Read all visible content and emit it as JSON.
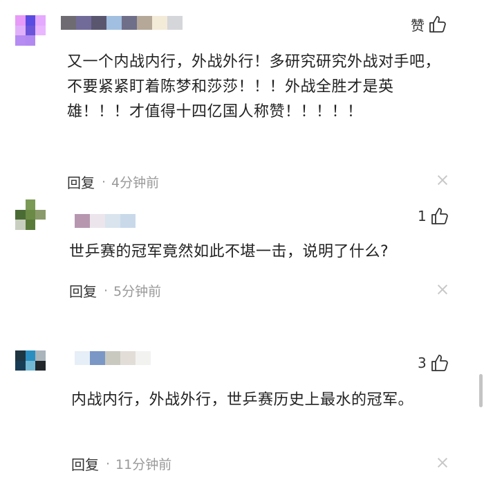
{
  "comments": [
    {
      "like_label": "赞",
      "content": "又一个内战内行，外战外行！多研究研究外战对手吧，不要紧紧盯着陈梦和莎莎！！！外战全胜才是英雄！！！才值得十四亿国人称赞！！！！！",
      "reply_label": "回复",
      "dot": "·",
      "time": "4分钟前",
      "avatar_colors": [
        "#e79af7",
        "#5a4be2",
        "#e5a9ff",
        "#e1b0fb",
        "#6b54d9",
        "#e9b6ff",
        "#b68bf2",
        "#b289f0",
        "#ffffff"
      ],
      "name_colors": [
        "#6e6c72",
        "#716b99",
        "#5b5670",
        "#a1bfe0",
        "#6f6f8a",
        "#b5a898",
        "#f3ead8",
        "#d4d6da"
      ]
    },
    {
      "like_count": "1",
      "content": "世乒赛的冠军竟然如此不堪一击，说明了什么?",
      "reply_label": "回复",
      "dot": "·",
      "time": "5分钟前",
      "avatar_colors": [
        "#ffffff",
        "#7a9a55",
        "#ffffff",
        "#4b6b35",
        "#6a8a45",
        "#8a9a6a",
        "#c9cfc0",
        "#5a7a3a",
        "#ffffff"
      ],
      "name_colors": [
        "#b797b0",
        "#ece6ec",
        "#d9e4ee",
        "#c9d9ea",
        "#ffffff"
      ]
    },
    {
      "like_count": "3",
      "content": "内战内行，外战外行，世乒赛历史上最水的冠军。",
      "reply_label": "回复",
      "dot": "·",
      "time": "11分钟前",
      "avatar_colors": [
        "#1e3542",
        "#2a8fc0",
        "#a9b4bb",
        "#163d55",
        "#73b9d6",
        "#22272b",
        "#ffffff",
        "#ffffff",
        "#ffffff"
      ],
      "name_colors": [
        "#e6eef7",
        "#7b97c5",
        "#c9c9c0",
        "#e2ded7",
        "#f2f3f0"
      ]
    }
  ]
}
